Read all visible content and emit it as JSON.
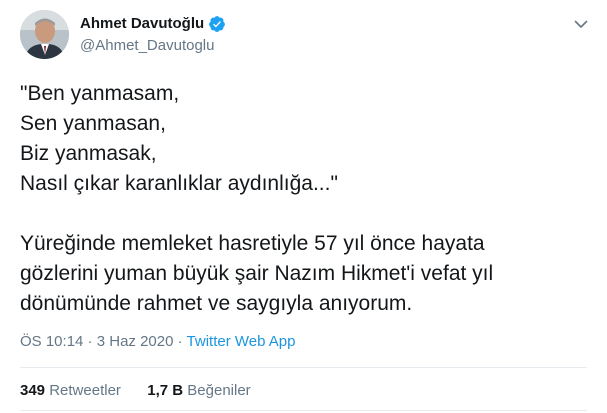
{
  "author": {
    "display_name": "Ahmet Davutoğlu",
    "handle": "@Ahmet_Davutoglu",
    "verified": true,
    "avatar_icon": "profile-photo"
  },
  "tweet": {
    "text": "\"Ben yanmasam,\nSen yanmasan,\nBiz yanmasak,\nNasıl çıkar karanlıklar aydınlığa...\"\n\nYüreğinde memleket hasretiyle 57 yıl önce hayata\ngözlerini yuman büyük şair Nazım Hikmet'i vefat yıl\ndönümünde rahmet ve saygıyla anıyorum."
  },
  "meta": {
    "time": "ÖS 10:14",
    "separator": " · ",
    "date": "3 Haz 2020",
    "source": "Twitter Web App"
  },
  "stats": {
    "retweets_count": "349",
    "retweets_label": "Retweetler",
    "likes_count": "1,7 B",
    "likes_label": "Beğeniler"
  },
  "colors": {
    "accent": "#1b95e0",
    "verified": "#1da1f2",
    "secondary_text": "#657786",
    "primary_text": "#14171a"
  }
}
